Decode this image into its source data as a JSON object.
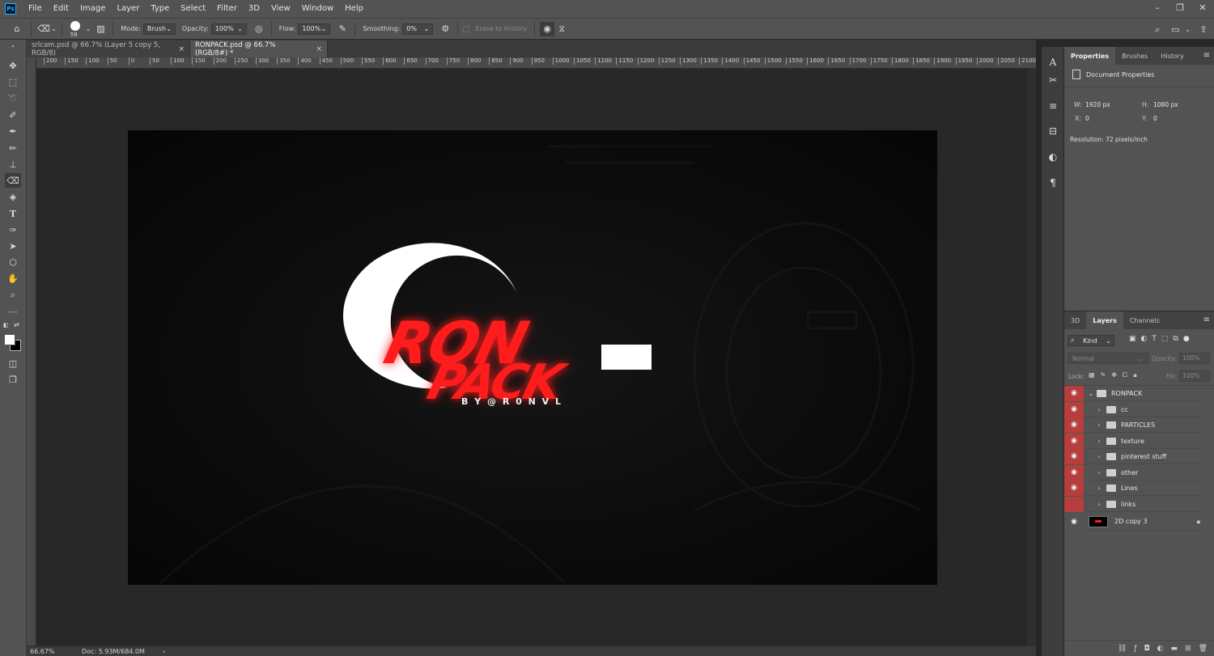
{
  "menubar": {
    "logo": "Ps",
    "items": [
      "File",
      "Edit",
      "Image",
      "Layer",
      "Type",
      "Select",
      "Filter",
      "3D",
      "View",
      "Window",
      "Help"
    ],
    "window_controls": [
      "–",
      "❐",
      "✕"
    ]
  },
  "options": {
    "brush_size": "59",
    "mode_label": "Mode:",
    "mode_value": "Brush",
    "opacity_label": "Opacity:",
    "opacity_value": "100%",
    "flow_label": "Flow:",
    "flow_value": "100%",
    "smoothing_label": "Smoothing:",
    "smoothing_value": "0%",
    "erase_history_label": "Erase to History"
  },
  "tabs": [
    {
      "label": "srlcam.psd @ 66.7% (Layer 5 copy 5, RGB/8)",
      "close": "×"
    },
    {
      "label": "RONPACK.psd @ 66.7% (RGB/8#) *",
      "close": "×"
    }
  ],
  "ruler": {
    "h_ticks": [
      "200",
      "150",
      "100",
      "50",
      "0",
      "50",
      "100",
      "150",
      "200",
      "250",
      "300",
      "350",
      "400",
      "450",
      "500",
      "550",
      "600",
      "650",
      "700",
      "750",
      "800",
      "850",
      "900",
      "950",
      "1000",
      "1050",
      "1100",
      "1150",
      "1200",
      "1250",
      "1300",
      "1350",
      "1400",
      "1450",
      "1500",
      "1550",
      "1600",
      "1650",
      "1700",
      "1750",
      "1800",
      "1850",
      "1900",
      "1950",
      "2000",
      "2050",
      "2100"
    ]
  },
  "artwork": {
    "line1": "RON",
    "line2": "PACK",
    "byline": "B Y   @ R 0 N V L",
    "accent": "#ff1a1a"
  },
  "status": {
    "zoom": "66.67%",
    "doc": "Doc: 5.93M/684.0M"
  },
  "properties": {
    "tabs": [
      "Properties",
      "Brushes",
      "History"
    ],
    "title": "Document Properties",
    "w_label": "W:",
    "w_value": "1920 px",
    "h_label": "H:",
    "h_value": "1080 px",
    "x_label": "X:",
    "x_value": "0",
    "y_label": "Y:",
    "y_value": "0",
    "resolution": "Resolution: 72 pixels/inch"
  },
  "layers_panel": {
    "tabs": [
      "3D",
      "Layers",
      "Channels"
    ],
    "kind": "Kind",
    "blend": "Normal",
    "opacity_label": "Opacity:",
    "opacity_value": "100%",
    "lock_label": "Lock:",
    "fill_label": "Fill:",
    "fill_value": "100%",
    "group": "RONPACK",
    "children": [
      "cc",
      "PARTICLES",
      "texture",
      "pinterest stuff",
      "other",
      "Lines",
      "links"
    ],
    "layer": "2D copy 3"
  }
}
